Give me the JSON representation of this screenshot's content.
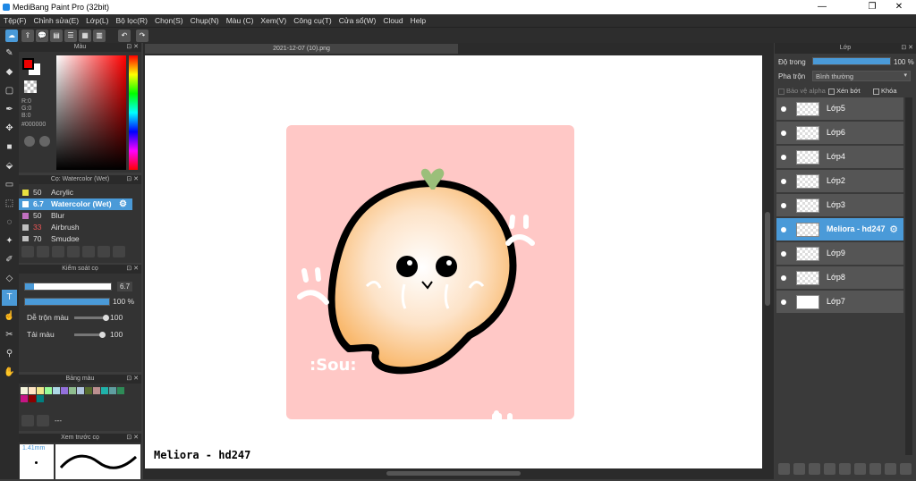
{
  "window": {
    "title": "MediBang Paint Pro (32bit)"
  },
  "menu": [
    "Tệp(F)",
    "Chỉnh sửa(E)",
    "Lớp(L)",
    "Bộ lọc(R)",
    "Chọn(S)",
    "Chụp(N)",
    "Màu (C)",
    "Xem(V)",
    "Công cụ(T)",
    "Cửa sổ(W)",
    "Cloud",
    "Help"
  ],
  "color_panel": {
    "title": "Màu",
    "r": "R:0",
    "g": "G:0",
    "b": "B:0",
    "hex": "#000000",
    "foreground": "#e00000",
    "background": "#ffffff"
  },
  "brush_panel": {
    "title": "Cọ: Watercolor (Wet)",
    "brushes": [
      {
        "size": "50",
        "name": "Acrylic",
        "color": "#e8e040"
      },
      {
        "size": "6.7",
        "name": "Watercolor (Wet)",
        "color": "#60b0e0"
      },
      {
        "size": "50",
        "name": "Blur",
        "color": "#c070c0"
      },
      {
        "size": "33",
        "name": "Airbrush",
        "color": "#c0c0c0"
      },
      {
        "size": "70",
        "name": "Smudge",
        "color": "#c0c0c0"
      }
    ]
  },
  "control_panel": {
    "title": "Kiểm soát cọ",
    "size_value": "6.7",
    "opacity_value": "100 %",
    "opacity_fraction": 1.0,
    "mix_label": "Dễ trộn màu",
    "mix_value": "100",
    "load_label": "Tải màu",
    "load_value": "100"
  },
  "palette_panel": {
    "title": "Bảng màu",
    "colors": [
      "#f5f5dc",
      "#ffe4c4",
      "#f0e68c",
      "#98fb98",
      "#add8e6",
      "#9370db",
      "#8fbc8f",
      "#b0c4de",
      "#556b2f",
      "#bc8f8f",
      "#20b2aa",
      "#5f9ea0",
      "#2e8b57",
      "#c71585",
      "#8b0000",
      "#008080"
    ],
    "empty": "---"
  },
  "preview_panel": {
    "title": "Xem trước cọ",
    "size": "1.41mm"
  },
  "document": {
    "tab": "2021-12-07 (10).png",
    "artwork_text": ":Sou:",
    "signature": "Meliora - hd247"
  },
  "layer_panel": {
    "title": "Lớp",
    "opacity_label": "Độ trong",
    "opacity_value": "100 %",
    "opacity_fraction": 1.0,
    "blend_label": "Pha trộn",
    "blend_value": "Bình thường",
    "protect_alpha": "Bảo vệ alpha",
    "clipping": "Xén bớt",
    "lock": "Khóa",
    "layers": [
      {
        "name": "Lớp5",
        "selected": false
      },
      {
        "name": "Lớp6",
        "selected": false
      },
      {
        "name": "Lớp4",
        "selected": false
      },
      {
        "name": "Lớp2",
        "selected": false
      },
      {
        "name": "Lớp3",
        "selected": false
      },
      {
        "name": "Meliora - hd247",
        "selected": true
      },
      {
        "name": "Lớp9",
        "selected": false
      },
      {
        "name": "Lớp8",
        "selected": false
      },
      {
        "name": "Lớp7",
        "selected": false
      }
    ]
  }
}
